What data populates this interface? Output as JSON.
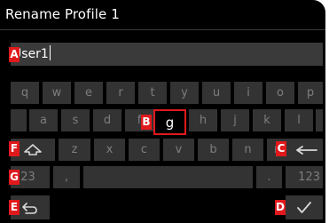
{
  "title": "Rename Profile 1",
  "input": {
    "value": "User1"
  },
  "rows": {
    "row1": [
      "q",
      "w",
      "e",
      "r",
      "t",
      "y",
      "u",
      "i",
      "o",
      "p"
    ],
    "row2": [
      "a",
      "s",
      "d",
      "f",
      "g",
      "h",
      "j",
      "k",
      "l"
    ],
    "row3": [
      "z",
      "x",
      "c",
      "v",
      "b",
      "n",
      "m"
    ]
  },
  "keys": {
    "numbers_label": "123",
    "comma_label": ",",
    "period_label": ".",
    "numbers_right_label": "123"
  },
  "selected_key": "g",
  "markers": {
    "a": "A",
    "b": "B",
    "c": "C",
    "d": "D",
    "e": "E",
    "f": "F",
    "g": "G"
  },
  "colors": {
    "marker": "#e0191c",
    "key_bg": "#333333",
    "key_text": "#7d7d7d",
    "input_bg": "#3a3a3a"
  },
  "icons": {
    "shift": "shift-arrow-icon",
    "backspace": "backspace-arrow-icon",
    "back": "back-return-icon",
    "confirm": "checkmark-icon"
  }
}
